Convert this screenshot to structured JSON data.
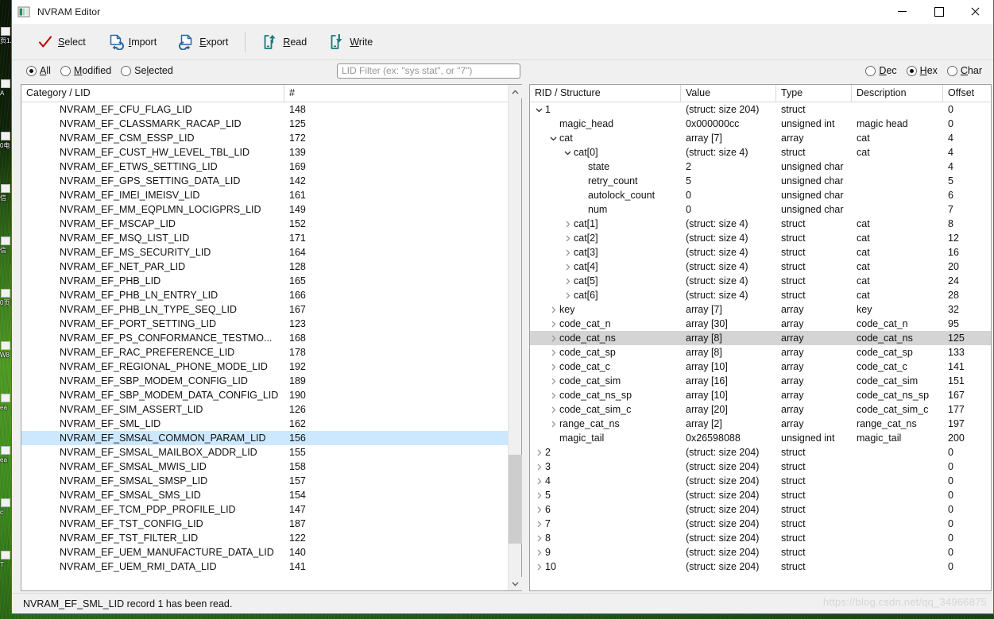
{
  "window": {
    "title": "NVRAM Editor",
    "icon": "app-icon",
    "minimize_label": "Minimize",
    "maximize_label": "Maximize",
    "close_label": "Close"
  },
  "toolbar": {
    "items": [
      {
        "label": "Select",
        "mnemonic": "S",
        "icon": "check-icon"
      },
      {
        "label": "Import",
        "mnemonic": "I",
        "icon": "import-file-icon"
      },
      {
        "label": "Export",
        "mnemonic": "E",
        "icon": "export-file-icon"
      },
      {
        "label": "Read",
        "mnemonic": "R",
        "icon": "phone-upload-icon"
      },
      {
        "label": "Write",
        "mnemonic": "W",
        "icon": "phone-download-icon"
      }
    ]
  },
  "filterbar": {
    "scope_options": [
      {
        "label": "All",
        "mnemonic": "A",
        "selected": true
      },
      {
        "label": "Modified",
        "mnemonic": "M",
        "selected": false
      },
      {
        "label": "Selected",
        "mnemonic": "l",
        "selected": false
      }
    ],
    "lid_filter": {
      "value": "",
      "placeholder": "LID Filter (ex: \"sys stat\", or \"7\")"
    },
    "format_options": [
      {
        "label": "Dec",
        "mnemonic": "D",
        "selected": false
      },
      {
        "label": "Hex",
        "mnemonic": "H",
        "selected": true
      },
      {
        "label": "Char",
        "mnemonic": "C",
        "selected": false
      }
    ]
  },
  "lid_list": {
    "columns": [
      "Category / LID",
      "#"
    ],
    "selected_index": 23,
    "rows": [
      {
        "name": "NVRAM_EF_CFU_FLAG_LID",
        "num": "148"
      },
      {
        "name": "NVRAM_EF_CLASSMARK_RACAP_LID",
        "num": "125"
      },
      {
        "name": "NVRAM_EF_CSM_ESSP_LID",
        "num": "172"
      },
      {
        "name": "NVRAM_EF_CUST_HW_LEVEL_TBL_LID",
        "num": "139"
      },
      {
        "name": "NVRAM_EF_ETWS_SETTING_LID",
        "num": "169"
      },
      {
        "name": "NVRAM_EF_GPS_SETTING_DATA_LID",
        "num": "142"
      },
      {
        "name": "NVRAM_EF_IMEI_IMEISV_LID",
        "num": "161"
      },
      {
        "name": "NVRAM_EF_MM_EQPLMN_LOCIGPRS_LID",
        "num": "149"
      },
      {
        "name": "NVRAM_EF_MSCAP_LID",
        "num": "152"
      },
      {
        "name": "NVRAM_EF_MSQ_LIST_LID",
        "num": "171"
      },
      {
        "name": "NVRAM_EF_MS_SECURITY_LID",
        "num": "164"
      },
      {
        "name": "NVRAM_EF_NET_PAR_LID",
        "num": "128"
      },
      {
        "name": "NVRAM_EF_PHB_LID",
        "num": "165"
      },
      {
        "name": "NVRAM_EF_PHB_LN_ENTRY_LID",
        "num": "166"
      },
      {
        "name": "NVRAM_EF_PHB_LN_TYPE_SEQ_LID",
        "num": "167"
      },
      {
        "name": "NVRAM_EF_PORT_SETTING_LID",
        "num": "123"
      },
      {
        "name": "NVRAM_EF_PS_CONFORMANCE_TESTMO...",
        "num": "168"
      },
      {
        "name": "NVRAM_EF_RAC_PREFERENCE_LID",
        "num": "178"
      },
      {
        "name": "NVRAM_EF_REGIONAL_PHONE_MODE_LID",
        "num": "192"
      },
      {
        "name": "NVRAM_EF_SBP_MODEM_CONFIG_LID",
        "num": "189"
      },
      {
        "name": "NVRAM_EF_SBP_MODEM_DATA_CONFIG_LID",
        "num": "190"
      },
      {
        "name": "NVRAM_EF_SIM_ASSERT_LID",
        "num": "126"
      },
      {
        "name": "NVRAM_EF_SML_LID",
        "num": "162"
      },
      {
        "name": "NVRAM_EF_SMSAL_COMMON_PARAM_LID",
        "num": "156"
      },
      {
        "name": "NVRAM_EF_SMSAL_MAILBOX_ADDR_LID",
        "num": "155"
      },
      {
        "name": "NVRAM_EF_SMSAL_MWIS_LID",
        "num": "158"
      },
      {
        "name": "NVRAM_EF_SMSAL_SMSP_LID",
        "num": "157"
      },
      {
        "name": "NVRAM_EF_SMSAL_SMS_LID",
        "num": "154"
      },
      {
        "name": "NVRAM_EF_TCM_PDP_PROFILE_LID",
        "num": "147"
      },
      {
        "name": "NVRAM_EF_TST_CONFIG_LID",
        "num": "187"
      },
      {
        "name": "NVRAM_EF_TST_FILTER_LID",
        "num": "122"
      },
      {
        "name": "NVRAM_EF_UEM_MANUFACTURE_DATA_LID",
        "num": "140"
      },
      {
        "name": "NVRAM_EF_UEM_RMI_DATA_LID",
        "num": "141"
      }
    ]
  },
  "structure_tree": {
    "columns": [
      "RID / Structure",
      "Value",
      "Type",
      "Description",
      "Offset"
    ],
    "selected_index": 16,
    "rows": [
      {
        "name": "1",
        "indent": 0,
        "twisty": "expanded",
        "value": "(struct: size 204)",
        "type": "struct",
        "desc": "",
        "offset": "0"
      },
      {
        "name": "magic_head",
        "indent": 1,
        "twisty": "none",
        "value": "0x000000cc",
        "type": "unsigned int",
        "desc": "magic head",
        "offset": "0"
      },
      {
        "name": "cat",
        "indent": 1,
        "twisty": "expanded",
        "value": "array [7]",
        "type": "array",
        "desc": "cat",
        "offset": "4"
      },
      {
        "name": "cat[0]",
        "indent": 2,
        "twisty": "expanded",
        "value": "(struct: size 4)",
        "type": "struct",
        "desc": "cat",
        "offset": "4"
      },
      {
        "name": "state",
        "indent": 3,
        "twisty": "none",
        "value": "2",
        "type": "unsigned char",
        "desc": "",
        "offset": "4"
      },
      {
        "name": "retry_count",
        "indent": 3,
        "twisty": "none",
        "value": "5",
        "type": "unsigned char",
        "desc": "",
        "offset": "5"
      },
      {
        "name": "autolock_count",
        "indent": 3,
        "twisty": "none",
        "value": "0",
        "type": "unsigned char",
        "desc": "",
        "offset": "6"
      },
      {
        "name": "num",
        "indent": 3,
        "twisty": "none",
        "value": "0",
        "type": "unsigned char",
        "desc": "",
        "offset": "7"
      },
      {
        "name": "cat[1]",
        "indent": 2,
        "twisty": "collapsed",
        "value": "(struct: size 4)",
        "type": "struct",
        "desc": "cat",
        "offset": "8"
      },
      {
        "name": "cat[2]",
        "indent": 2,
        "twisty": "collapsed",
        "value": "(struct: size 4)",
        "type": "struct",
        "desc": "cat",
        "offset": "12"
      },
      {
        "name": "cat[3]",
        "indent": 2,
        "twisty": "collapsed",
        "value": "(struct: size 4)",
        "type": "struct",
        "desc": "cat",
        "offset": "16"
      },
      {
        "name": "cat[4]",
        "indent": 2,
        "twisty": "collapsed",
        "value": "(struct: size 4)",
        "type": "struct",
        "desc": "cat",
        "offset": "20"
      },
      {
        "name": "cat[5]",
        "indent": 2,
        "twisty": "collapsed",
        "value": "(struct: size 4)",
        "type": "struct",
        "desc": "cat",
        "offset": "24"
      },
      {
        "name": "cat[6]",
        "indent": 2,
        "twisty": "collapsed",
        "value": "(struct: size 4)",
        "type": "struct",
        "desc": "cat",
        "offset": "28"
      },
      {
        "name": "key",
        "indent": 1,
        "twisty": "collapsed",
        "value": "array [7]",
        "type": "array",
        "desc": "key",
        "offset": "32"
      },
      {
        "name": "code_cat_n",
        "indent": 1,
        "twisty": "collapsed",
        "value": "array [30]",
        "type": "array",
        "desc": "code_cat_n",
        "offset": "95"
      },
      {
        "name": "code_cat_ns",
        "indent": 1,
        "twisty": "collapsed",
        "value": "array [8]",
        "type": "array",
        "desc": "code_cat_ns",
        "offset": "125"
      },
      {
        "name": "code_cat_sp",
        "indent": 1,
        "twisty": "collapsed",
        "value": "array [8]",
        "type": "array",
        "desc": "code_cat_sp",
        "offset": "133"
      },
      {
        "name": "code_cat_c",
        "indent": 1,
        "twisty": "collapsed",
        "value": "array [10]",
        "type": "array",
        "desc": "code_cat_c",
        "offset": "141"
      },
      {
        "name": "code_cat_sim",
        "indent": 1,
        "twisty": "collapsed",
        "value": "array [16]",
        "type": "array",
        "desc": "code_cat_sim",
        "offset": "151"
      },
      {
        "name": "code_cat_ns_sp",
        "indent": 1,
        "twisty": "collapsed",
        "value": "array [10]",
        "type": "array",
        "desc": "code_cat_ns_sp",
        "offset": "167"
      },
      {
        "name": "code_cat_sim_c",
        "indent": 1,
        "twisty": "collapsed",
        "value": "array [20]",
        "type": "array",
        "desc": "code_cat_sim_c",
        "offset": "177"
      },
      {
        "name": "range_cat_ns",
        "indent": 1,
        "twisty": "collapsed",
        "value": "array [2]",
        "type": "array",
        "desc": "range_cat_ns",
        "offset": "197"
      },
      {
        "name": "magic_tail",
        "indent": 1,
        "twisty": "none",
        "value": "0x26598088",
        "type": "unsigned int",
        "desc": "magic_tail",
        "offset": "200"
      },
      {
        "name": "2",
        "indent": 0,
        "twisty": "collapsed",
        "value": "(struct: size 204)",
        "type": "struct",
        "desc": "",
        "offset": "0"
      },
      {
        "name": "3",
        "indent": 0,
        "twisty": "collapsed",
        "value": "(struct: size 204)",
        "type": "struct",
        "desc": "",
        "offset": "0"
      },
      {
        "name": "4",
        "indent": 0,
        "twisty": "collapsed",
        "value": "(struct: size 204)",
        "type": "struct",
        "desc": "",
        "offset": "0"
      },
      {
        "name": "5",
        "indent": 0,
        "twisty": "collapsed",
        "value": "(struct: size 204)",
        "type": "struct",
        "desc": "",
        "offset": "0"
      },
      {
        "name": "6",
        "indent": 0,
        "twisty": "collapsed",
        "value": "(struct: size 204)",
        "type": "struct",
        "desc": "",
        "offset": "0"
      },
      {
        "name": "7",
        "indent": 0,
        "twisty": "collapsed",
        "value": "(struct: size 204)",
        "type": "struct",
        "desc": "",
        "offset": "0"
      },
      {
        "name": "8",
        "indent": 0,
        "twisty": "collapsed",
        "value": "(struct: size 204)",
        "type": "struct",
        "desc": "",
        "offset": "0"
      },
      {
        "name": "9",
        "indent": 0,
        "twisty": "collapsed",
        "value": "(struct: size 204)",
        "type": "struct",
        "desc": "",
        "offset": "0"
      },
      {
        "name": "10",
        "indent": 0,
        "twisty": "collapsed",
        "value": "(struct: size 204)",
        "type": "struct",
        "desc": "",
        "offset": "0"
      }
    ]
  },
  "statusbar": {
    "message": "NVRAM_EF_SML_LID record 1 has been read."
  },
  "watermark": {
    "text": "https://blog.csdn.net/qq_34966875"
  },
  "desktop_icons": [
    {
      "label": "页1."
    },
    {
      "label": "A"
    },
    {
      "label": "0电"
    },
    {
      "label": "信"
    },
    {
      "label": "信"
    },
    {
      "label": "0页"
    },
    {
      "label": "W8"
    },
    {
      "label": "ea"
    },
    {
      "label": "ea"
    },
    {
      "label": "c"
    },
    {
      "label": "T"
    }
  ],
  "colors": {
    "window_border": "#0078d7",
    "selection_blue": "#cce8ff",
    "selection_gray": "#d4d4d4",
    "toolbar_bg": "#f0f0f0",
    "icon_blue": "#2b6699",
    "icon_teal": "#1c7a7a",
    "icon_red": "#c00000"
  }
}
